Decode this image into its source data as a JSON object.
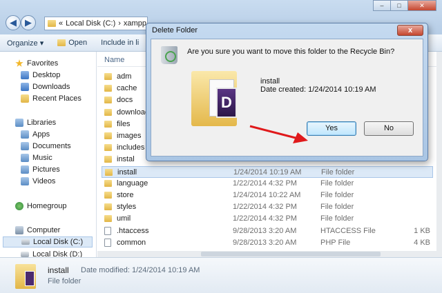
{
  "window": {
    "breadcrumb": [
      "Local Disk (C:)",
      "xampp"
    ],
    "back_glyph": "◀",
    "forward_glyph": "▶"
  },
  "toolbar": {
    "organize": "Organize ▾",
    "open": "Open",
    "include": "Include in li"
  },
  "nav": {
    "favorites": "Favorites",
    "desktop": "Desktop",
    "downloads": "Downloads",
    "recent": "Recent Places",
    "libraries": "Libraries",
    "apps": "Apps",
    "documents": "Documents",
    "music": "Music",
    "pictures": "Pictures",
    "videos": "Videos",
    "homegroup": "Homegroup",
    "computer": "Computer",
    "drive_c": "Local Disk (C:)",
    "drive_d": "Local Disk (D:)"
  },
  "files": {
    "header_name": "Name",
    "rows": [
      {
        "name": "adm",
        "date": "",
        "type": "",
        "size": ""
      },
      {
        "name": "cache",
        "date": "",
        "type": "",
        "size": ""
      },
      {
        "name": "docs",
        "date": "",
        "type": "",
        "size": ""
      },
      {
        "name": "download",
        "date": "",
        "type": "",
        "size": ""
      },
      {
        "name": "files",
        "date": "",
        "type": "",
        "size": ""
      },
      {
        "name": "images",
        "date": "",
        "type": "",
        "size": ""
      },
      {
        "name": "includes",
        "date": "",
        "type": "",
        "size": ""
      },
      {
        "name": "instal",
        "date": "",
        "type": "",
        "size": ""
      },
      {
        "name": "install",
        "date": "1/24/2014 10:19 AM",
        "type": "File folder",
        "size": ""
      },
      {
        "name": "language",
        "date": "1/22/2014 4:32 PM",
        "type": "File folder",
        "size": ""
      },
      {
        "name": "store",
        "date": "1/24/2014 10:22 AM",
        "type": "File folder",
        "size": ""
      },
      {
        "name": "styles",
        "date": "1/22/2014 4:32 PM",
        "type": "File folder",
        "size": ""
      },
      {
        "name": "umil",
        "date": "1/22/2014 4:32 PM",
        "type": "File folder",
        "size": ""
      },
      {
        "name": ".htaccess",
        "date": "9/28/2013 3:20 AM",
        "type": "HTACCESS File",
        "size": "1 KB"
      },
      {
        "name": "common",
        "date": "9/28/2013 3:20 AM",
        "type": "PHP File",
        "size": "4 KB"
      }
    ]
  },
  "details": {
    "name": "install",
    "modified": "Date modified: 1/24/2014 10:19 AM",
    "type": "File folder"
  },
  "dialog": {
    "title": "Delete Folder",
    "close": "x",
    "question": "Are you sure you want to move this folder to the Recycle Bin?",
    "folder_name": "install",
    "date_created": "Date created: 1/24/2014 10:19 AM",
    "thumb_letter": "D",
    "yes": "Yes",
    "no": "No"
  },
  "colors": {
    "arrow": "#e0191b",
    "selection": "#dce9f7"
  }
}
